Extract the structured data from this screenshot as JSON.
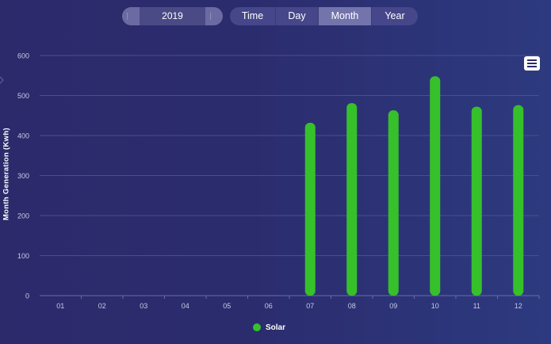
{
  "year_picker": {
    "value": "2019",
    "prev_icon": "step-back-icon",
    "next_icon": "step-forward-icon"
  },
  "period_tabs": [
    {
      "label": "Time",
      "active": false
    },
    {
      "label": "Day",
      "active": false
    },
    {
      "label": "Month",
      "active": true
    },
    {
      "label": "Year",
      "active": false
    }
  ],
  "menu_icon": "hamburger-menu-icon",
  "colors": {
    "bar": "#36c12a",
    "grid": "#4d4d8c",
    "tick": "#c9c9e6"
  },
  "chart_data": {
    "type": "bar",
    "title": "",
    "xlabel": "",
    "ylabel": "Month Generation (Kwh)",
    "categories": [
      "01",
      "02",
      "03",
      "04",
      "05",
      "06",
      "07",
      "08",
      "09",
      "10",
      "11",
      "12"
    ],
    "series": [
      {
        "name": "Solar",
        "values": [
          0,
          0,
          0,
          0,
          0,
          0,
          432,
          481,
          463,
          548,
          472,
          476
        ]
      }
    ],
    "ylim": [
      0,
      600
    ],
    "yticks": [
      "0",
      "100",
      "200",
      "300",
      "400",
      "500",
      "600"
    ],
    "grid": true,
    "legend": "bottom-center"
  }
}
